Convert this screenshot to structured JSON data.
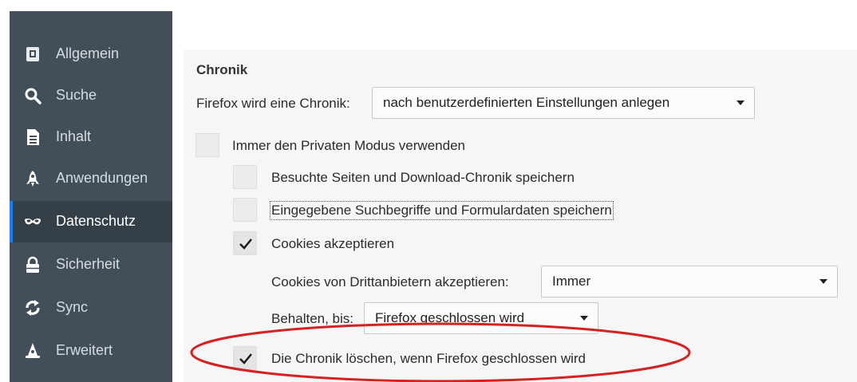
{
  "sidebar": {
    "items": [
      {
        "label": "Allgemein",
        "icon": "general-icon"
      },
      {
        "label": "Suche",
        "icon": "search-icon"
      },
      {
        "label": "Inhalt",
        "icon": "document-icon"
      },
      {
        "label": "Anwendungen",
        "icon": "rocket-icon"
      },
      {
        "label": "Datenschutz",
        "icon": "mask-icon",
        "active": true
      },
      {
        "label": "Sicherheit",
        "icon": "lock-icon"
      },
      {
        "label": "Sync",
        "icon": "sync-icon"
      },
      {
        "label": "Erweitert",
        "icon": "wizard-hat-icon"
      }
    ]
  },
  "history": {
    "title": "Chronik",
    "firefox_will_label": "Firefox wird eine Chronik:",
    "firefox_will_value": "nach benutzerdefinierten Einstellungen anlegen",
    "private_mode_label": "Immer den Privaten Modus verwenden",
    "private_mode_checked": false,
    "remember_history_label": "Besuchte Seiten und Download-Chronik speichern",
    "remember_history_checked": false,
    "remember_search_label": "Eingegebene Suchbegriffe und Formulardaten speichern",
    "remember_search_checked": false,
    "accept_cookies_label": "Cookies akzeptieren",
    "accept_cookies_checked": true,
    "third_party_label": "Cookies von Drittanbietern akzeptieren:",
    "third_party_value": "Immer",
    "keep_until_label": "Behalten, bis:",
    "keep_until_value": "Firefox geschlossen wird",
    "clear_on_close_label": "Die Chronik löschen, wenn Firefox geschlossen wird",
    "clear_on_close_checked": true
  },
  "colors": {
    "sidebar_bg": "#424f5a",
    "sidebar_active_bg": "#343f48",
    "highlight_ellipse": "#d42121"
  }
}
